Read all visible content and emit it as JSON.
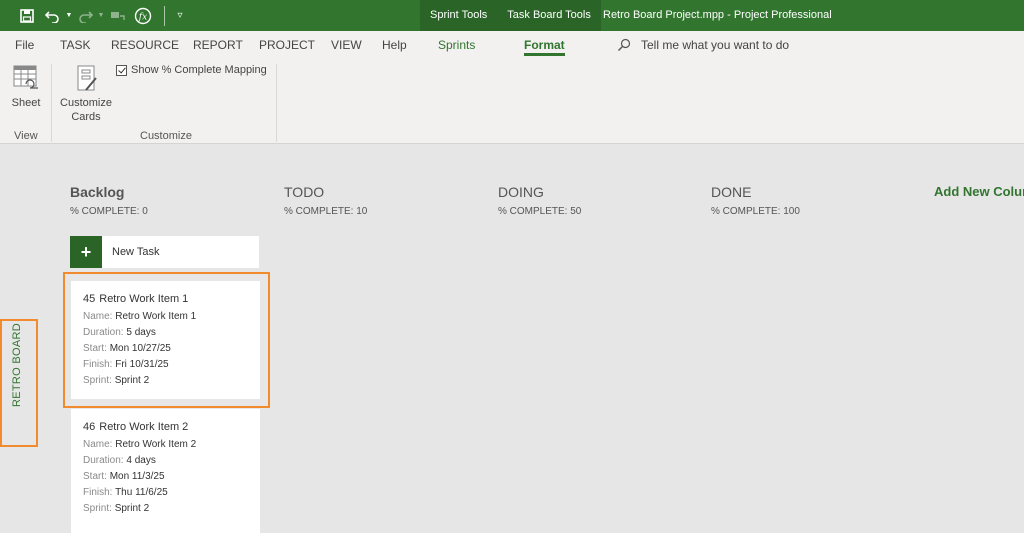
{
  "titlebar": {
    "qat": [
      {
        "name": "save-icon",
        "glyph": "🖫"
      },
      {
        "name": "undo-icon",
        "glyph": "↶"
      },
      {
        "name": "redo-icon",
        "glyph": "↷"
      },
      {
        "name": "link-tasks-icon",
        "glyph": "⚭"
      },
      {
        "name": "fx-icon",
        "glyph": "ƒx"
      },
      {
        "name": "customize-qat-icon",
        "glyph": "▿"
      }
    ],
    "contextual_tabs": [
      "Sprint Tools",
      "Task Board Tools"
    ],
    "window_title": "Retro Board Project.mpp  -  Project Professional"
  },
  "ribbon": {
    "tabs": {
      "file": "File",
      "task": "TASK",
      "resource": "RESOURCE",
      "report": "REPORT",
      "project": "PROJECT",
      "view": "VIEW",
      "help": "Help",
      "sprints": "Sprints",
      "format": "Format"
    },
    "active_tab": "Format",
    "tell_me": "Tell me what you want to do",
    "groups": {
      "view": {
        "label": "View",
        "sheet_button": "Sheet"
      },
      "customize": {
        "label": "Customize",
        "customize_cards_line1": "Customize",
        "customize_cards_line2": "Cards",
        "show_mapping_label": "Show % Complete Mapping",
        "show_mapping_checked": true
      }
    }
  },
  "board": {
    "side_label": "RETRO BOARD",
    "columns": [
      {
        "title": "Backlog",
        "pct": "% COMPLETE: 0"
      },
      {
        "title": "TODO",
        "pct": "% COMPLETE: 10"
      },
      {
        "title": "DOING",
        "pct": "% COMPLETE: 50"
      },
      {
        "title": "DONE",
        "pct": "% COMPLETE: 100"
      }
    ],
    "add_column": "Add New Column",
    "new_task": {
      "icon": "+",
      "label": "New Task"
    },
    "cards": [
      {
        "id": "45",
        "title": "Retro Work Item 1",
        "fields": [
          {
            "key": "Name:",
            "value": "Retro Work Item 1"
          },
          {
            "key": "Duration:",
            "value": "5 days"
          },
          {
            "key": "Start:",
            "value": "Mon 10/27/25"
          },
          {
            "key": "Finish:",
            "value": "Fri 10/31/25"
          },
          {
            "key": "Sprint:",
            "value": "Sprint 2"
          }
        ]
      },
      {
        "id": "46",
        "title": "Retro Work Item 2",
        "fields": [
          {
            "key": "Name:",
            "value": "Retro Work Item 2"
          },
          {
            "key": "Duration:",
            "value": "4 days"
          },
          {
            "key": "Start:",
            "value": "Mon 11/3/25"
          },
          {
            "key": "Finish:",
            "value": "Thu 11/6/25"
          },
          {
            "key": "Sprint:",
            "value": "Sprint 2"
          }
        ]
      }
    ]
  },
  "colors": {
    "brand_green": "#31752f",
    "context_green": "#2a6527",
    "highlight_orange": "#f28a2e",
    "board_bg": "#e6e6e6",
    "ribbon_bg": "#f2f1f0"
  }
}
